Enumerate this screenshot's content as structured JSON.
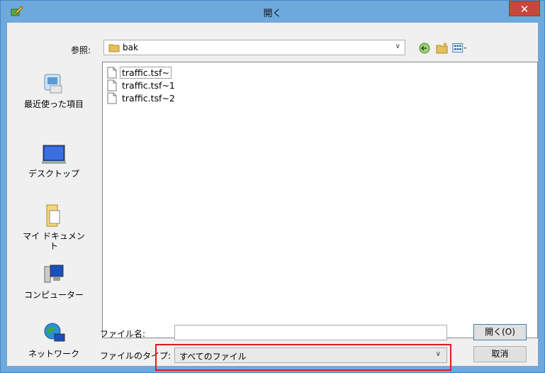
{
  "window": {
    "title": "開く",
    "close_symbol": "✕"
  },
  "lookin": {
    "label": "参照:",
    "value": "bak",
    "arrow": "∨"
  },
  "places": [
    {
      "label": "最近使った項目",
      "icon": "recent-items-icon"
    },
    {
      "label": "デスクトップ",
      "icon": "desktop-icon"
    },
    {
      "label": "マイ ドキュメント",
      "icon": "my-documents-icon"
    },
    {
      "label": "コンピューター",
      "icon": "computer-icon"
    },
    {
      "label": "ネットワーク",
      "icon": "network-icon"
    }
  ],
  "files": [
    "traffic.tsf~",
    "traffic.tsf~1",
    "traffic.tsf~2"
  ],
  "filename": {
    "label": "ファイル名:",
    "value": ""
  },
  "filetype": {
    "label": "ファイルのタイプ:",
    "value": "すべてのファイル",
    "arrow": "∨"
  },
  "buttons": {
    "open": "開く(O)",
    "cancel": "取消"
  },
  "colors": {
    "titlebar": "#6ea9dd",
    "close": "#c7473d",
    "highlight": "#e21b1b"
  }
}
